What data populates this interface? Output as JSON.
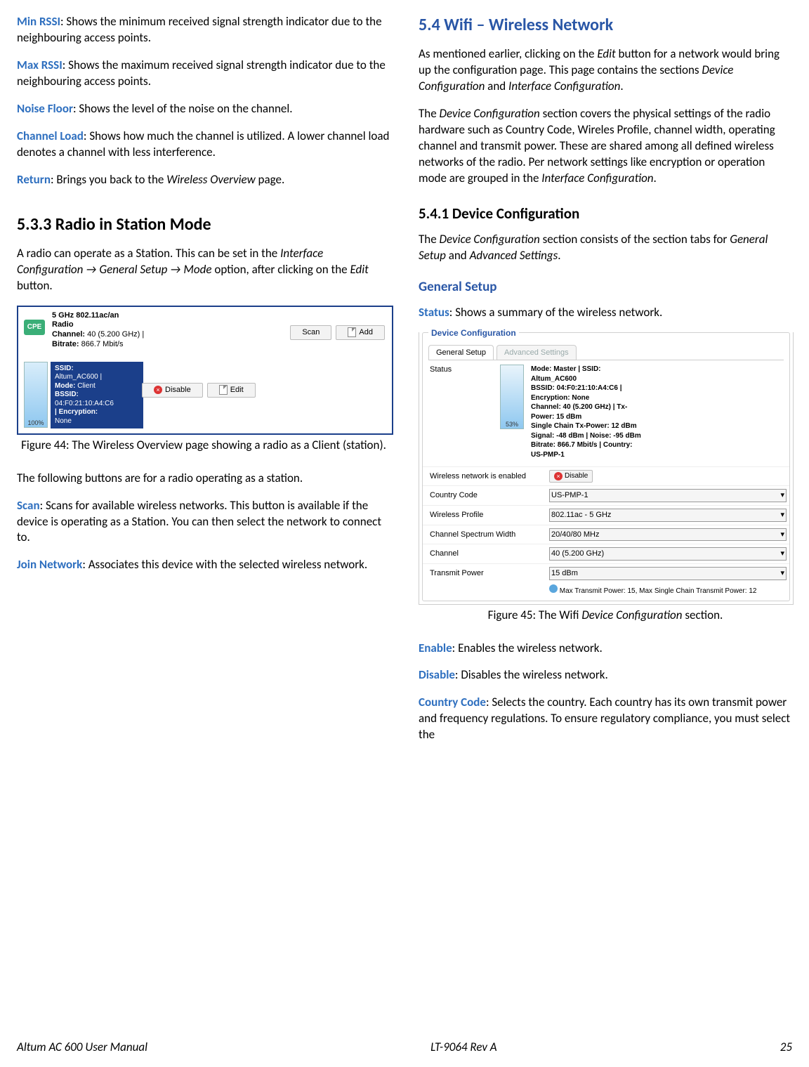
{
  "left": {
    "defs": [
      {
        "term": "Min RSSI",
        "text": ": Shows the minimum received signal strength indicator due to the neighbouring access points."
      },
      {
        "term": "Max RSSI",
        "text": ": Shows the maximum received signal strength indicator due to the neighbouring access points."
      },
      {
        "term": "Noise Floor",
        "text": ": Shows the level of the noise on the channel."
      },
      {
        "term": "Channel Load",
        "text": ": Shows how much the channel is utilized. A lower channel load denotes a channel with less interference."
      }
    ],
    "return": {
      "term": "Return",
      "pre": ": Brings you back to the ",
      "it": "Wireless Overview",
      "post": " page."
    },
    "h533": "5.3.3 Radio in Station Mode",
    "p533a_pre": "A radio can operate as a Station. This can be set in the ",
    "p533a_it1": "Interface Configuration → General Setup → Mode",
    "p533a_mid": " option, after clicking on the ",
    "p533a_it2": "Edit",
    "p533a_post": " button.",
    "fig44": {
      "badge": "CPE",
      "title1": "5 GHz 802.11ac/an",
      "title2": "Radio",
      "ch_lbl": "Channel:",
      "ch_val": " 40 (5.200 GHz) |",
      "br_lbl": "Bitrate:",
      "br_val": " 866.7 Mbit/s",
      "scan": "Scan",
      "add": "Add",
      "ssid_lbl": "SSID:",
      "ssid_val": "Altum_AC600 |",
      "mode_lbl": "Mode:",
      "mode_val": " Client",
      "bssid_lbl": "BSSID:",
      "bssid_val": "04:F0:21:10:A4:C6",
      "enc_lbl": "| Encryption:",
      "enc_val": "None",
      "pct": "100%",
      "disable": "Disable",
      "edit": "Edit",
      "caption": "Figure 44: The Wireless Overview page showing a radio as a Client (station)."
    },
    "after44": "The following buttons are for a radio operating as a station.",
    "scan": {
      "term": "Scan",
      "text": ": Scans for available wireless networks. This button is available if the device is operating as a Station. You can then select the network to connect to."
    },
    "join": {
      "term": "Join Network",
      "text": ": Associates this device with the selected wireless network."
    }
  },
  "right": {
    "h54": "5.4    Wifi – Wireless Network",
    "p54a_pre": "As mentioned earlier, clicking on the ",
    "p54a_it1": "Edit",
    "p54a_mid": " button for a network would bring up the configuration page. This page contains the sections ",
    "p54a_it2": "Device Configuration",
    "p54a_and": " and ",
    "p54a_it3": "Interface Configuration",
    "p54a_post": ".",
    "p54b_pre": "The ",
    "p54b_it1": "Device Configuration",
    "p54b_mid": " section covers the physical settings of the radio hardware such as Country Code, Wireles Profile, channel width, operating channel and transmit power. These are shared among all defined wireless networks of the radio. Per network settings like encryption or operation mode are grouped in the ",
    "p54b_it2": "Interface Configuration",
    "p54b_post": ".",
    "h541": "5.4.1 Device Configuration",
    "p541_pre": "The ",
    "p541_it1": "Device Configuration",
    "p541_mid": " section consists of the section tabs for ",
    "p541_it2": "General Setup",
    "p541_and": " and ",
    "p541_it3": "Advanced Settings",
    "p541_post": ".",
    "hgs": "General Setup",
    "status": {
      "term": "Status",
      "text": ": Shows a summary of the wireless network."
    },
    "fig45": {
      "legend": "Device Configuration",
      "tab1": "General Setup",
      "tab2": "Advanced Settings",
      "status_lbl": "Status",
      "pct": "53%",
      "line1a": "Mode:",
      "line1b": " Master | ",
      "line1c": "SSID:",
      "line2a": "Altum_AC600",
      "line3a": "BSSID:",
      "line3b": " 04:F0:21:10:A4:C6 |",
      "line4a": "Encryption:",
      "line4b": " None",
      "line5a": "Channel:",
      "line5b": " 40 (5.200 GHz) | ",
      "line5c": "Tx-",
      "line6a": "Power:",
      "line6b": " 15 dBm",
      "line7a": "Single Chain Tx-Power:",
      "line7b": " 12 dBm",
      "line8a": "Signal:",
      "line8b": " -48 dBm | ",
      "line8c": "Noise:",
      "line8d": " -95 dBm",
      "line9a": "Bitrate:",
      "line9b": " 866.7 Mbit/s | ",
      "line9c": "Country:",
      "line10a": "US-PMP-1",
      "row_en_lbl": "Wireless network is enabled",
      "row_en_btn": "Disable",
      "row_cc_lbl": "Country Code",
      "row_cc_val": "US-PMP-1",
      "row_wp_lbl": "Wireless Profile",
      "row_wp_val": "802.11ac - 5 GHz",
      "row_csw_lbl": "Channel Spectrum Width",
      "row_csw_val": "20/40/80 MHz",
      "row_ch_lbl": "Channel",
      "row_ch_val": "40 (5.200 GHz)",
      "row_tp_lbl": "Transmit Power",
      "row_tp_val": "15 dBm",
      "note": "Max Transmit Power: 15, Max Single Chain Transmit Power: 12",
      "caption_pre": "Figure 45: The Wifi ",
      "caption_it": "Device Configuration",
      "caption_post": " section."
    },
    "enable": {
      "term": "Enable",
      "text": ": Enables the wireless network."
    },
    "disable": {
      "term": "Disable",
      "text": ": Disables the wireless network."
    },
    "cc": {
      "term": "Country Code",
      "text": ": Selects the country. Each country has its own transmit power and frequency regulations. To ensure regulatory compliance, you must select the"
    }
  },
  "footer": {
    "left": "Altum AC 600 User Manual",
    "center": "LT-9064 Rev A",
    "right": "25"
  }
}
